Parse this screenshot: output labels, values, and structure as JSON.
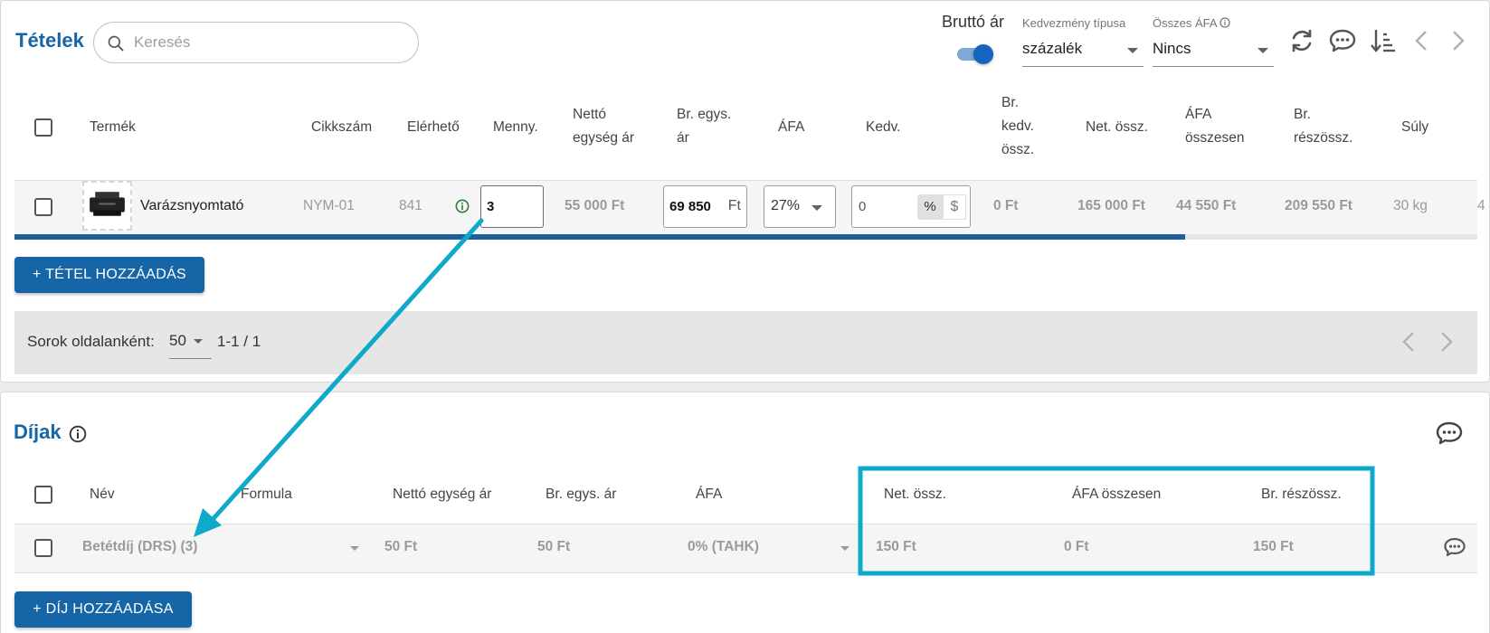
{
  "items_panel": {
    "title": "Tételek",
    "search_placeholder": "Keresés",
    "gross_price_label": "Bruttó ár",
    "gross_price_enabled": true,
    "discount_type": {
      "label": "Kedvezmény típusa",
      "value": "százalék"
    },
    "total_vat": {
      "label": "Összes ÁFA",
      "value": "Nincs"
    },
    "columns": {
      "product": "Termék",
      "sku": "Cikkszám",
      "available": "Elérhető",
      "qty": "Menny.",
      "net_unit_1": "Nettó",
      "net_unit_2": "egység ár",
      "gross_unit_1": "Br. egys.",
      "gross_unit_2": "ár",
      "vat": "ÁFA",
      "discount": "Kedv.",
      "gross_disc_1": "Br.",
      "gross_disc_2": "kedv.",
      "gross_disc_3": "össz.",
      "net_total": "Net. össz.",
      "vat_total_1": "ÁFA",
      "vat_total_2": "összesen",
      "gross_sub_1": "Br.",
      "gross_sub_2": "részössz.",
      "weight": "Súly"
    },
    "row": {
      "product": "Varázsnyomtató",
      "sku": "NYM-01",
      "available": "841",
      "qty": "3",
      "net_unit": "55 000 Ft",
      "gross_unit": "69 850",
      "gross_unit_currency": "Ft",
      "vat": "27%",
      "discount": "0",
      "discount_percent_symbol": "%",
      "discount_amount_symbol": "$",
      "gross_disc": "0 Ft",
      "net_total": "165 000 Ft",
      "vat_total": "44 550 Ft",
      "gross_sub": "209 550 Ft",
      "weight": "30 kg",
      "overflow_char": "4"
    },
    "add_button": "+ TÉTEL HOZZÁADÁS",
    "pagination": {
      "rows_per_page_label": "Sorok oldalanként:",
      "rows_per_page": "50",
      "range": "1-1 / 1"
    }
  },
  "fees_panel": {
    "title": "Díjak",
    "columns": {
      "name": "Név",
      "formula": "Formula",
      "net_unit": "Nettó egység ár",
      "gross_unit": "Br. egys. ár",
      "vat": "ÁFA",
      "net_total": "Net. össz.",
      "vat_total": "ÁFA összesen",
      "gross_sub": "Br. részössz."
    },
    "row": {
      "name": "Betétdíj (DRS) (3)",
      "net_unit": "50 Ft",
      "gross_unit": "50 Ft",
      "vat": "0% (TAHK)",
      "net_total": "150 Ft",
      "vat_total": "0 Ft",
      "gross_sub": "150 Ft"
    },
    "add_button": "+ DÍJ HOZZÁADÁSA"
  },
  "colors": {
    "primary": "#1565a7",
    "annotation": "#0fa9c9"
  }
}
